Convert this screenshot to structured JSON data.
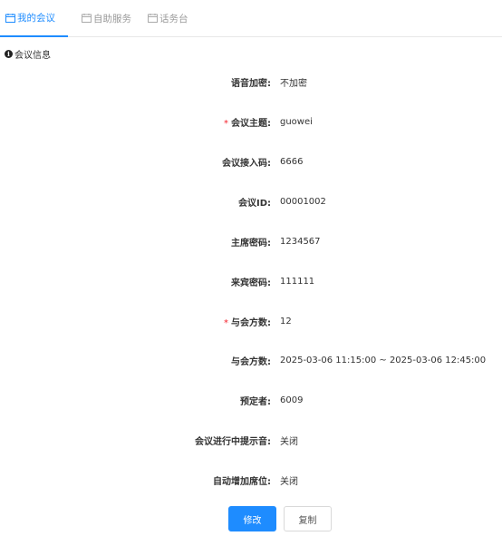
{
  "tabs": [
    {
      "label": "我的会议",
      "icon": "calendar-icon",
      "active": true
    },
    {
      "label": "自助服务",
      "icon": "calendar-icon",
      "active": false
    },
    {
      "label": "话务台",
      "icon": "calendar-icon",
      "active": false
    }
  ],
  "section": {
    "title": "会议信息",
    "icon": "info-icon"
  },
  "fields": [
    {
      "label": "语音加密:",
      "value": "不加密",
      "required": false
    },
    {
      "label": "会议主题:",
      "value": "guowei",
      "required": true
    },
    {
      "label": "会议接入码:",
      "value": "6666",
      "required": false
    },
    {
      "label": "会议ID:",
      "value": "00001002",
      "required": false
    },
    {
      "label": "主席密码:",
      "value": "1234567",
      "required": false
    },
    {
      "label": "来宾密码:",
      "value": "111111",
      "required": false
    },
    {
      "label": "与会方数:",
      "value": "12",
      "required": true
    },
    {
      "label": "与会方数:",
      "value": "2025-03-06 11:15:00 ~ 2025-03-06 12:45:00",
      "required": false
    },
    {
      "label": "预定者:",
      "value": "6009",
      "required": false
    },
    {
      "label": "会议进行中提示音:",
      "value": "关闭",
      "required": false
    },
    {
      "label": "自动增加席位:",
      "value": "关闭",
      "required": false
    }
  ],
  "required_mark": "*",
  "buttons": {
    "edit": "修改",
    "copy": "复制"
  },
  "colors": {
    "accent": "#1e8cff",
    "required": "#f5222d",
    "tab_inactive": "#999999"
  }
}
